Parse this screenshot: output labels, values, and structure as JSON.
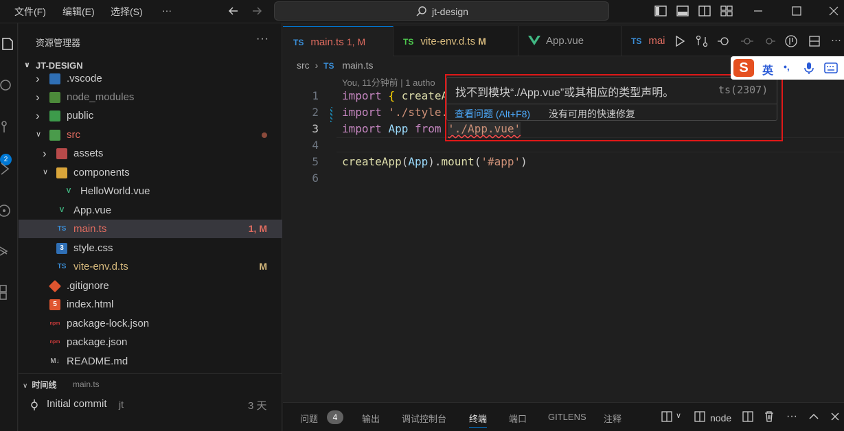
{
  "menu": [
    "文件(F)",
    "编辑(E)",
    "选择(S)",
    "···"
  ],
  "search": {
    "text": "jt-design"
  },
  "activity_badge": "2",
  "sidebar": {
    "title": "资源管理器",
    "more": "···",
    "project": "JT-DESIGN",
    "items": [
      {
        "name": ".vscode",
        "chevron": ">",
        "icon": "vscode-folder-icon",
        "color": "#cccccc"
      },
      {
        "name": "node_modules",
        "chevron": ">",
        "icon": "node-folder-icon",
        "color": "#8a8a8a"
      },
      {
        "name": "public",
        "chevron": ">",
        "icon": "public-folder-icon",
        "color": "#cccccc"
      },
      {
        "name": "src",
        "chevron": "v",
        "icon": "src-folder-icon",
        "color": "#e06c60"
      },
      {
        "name": "assets",
        "chevron": ">",
        "icon": "assets-folder-icon",
        "color": "#cccccc"
      },
      {
        "name": "components",
        "chevron": "v",
        "icon": "components-folder-icon",
        "color": "#cccccc"
      },
      {
        "name": "HelloWorld.vue",
        "chevron": "",
        "icon": "vue-icon",
        "color": "#cccccc"
      },
      {
        "name": "App.vue",
        "chevron": "",
        "icon": "vue-icon",
        "color": "#cccccc"
      },
      {
        "name": "main.ts",
        "chevron": "",
        "icon": "ts-icon",
        "color": "#e06c60",
        "deco": "1, M"
      },
      {
        "name": "style.css",
        "chevron": "",
        "icon": "css-icon",
        "color": "#cccccc"
      },
      {
        "name": "vite-env.d.ts",
        "chevron": "",
        "icon": "ts-icon",
        "color": "#d7ba7d",
        "deco": "M"
      },
      {
        "name": ".gitignore",
        "chevron": "",
        "icon": "git-icon",
        "color": "#cccccc"
      },
      {
        "name": "index.html",
        "chevron": "",
        "icon": "html-icon",
        "color": "#cccccc"
      },
      {
        "name": "package-lock.json",
        "chevron": "",
        "icon": "npm-icon",
        "color": "#cccccc"
      },
      {
        "name": "package.json",
        "chevron": "",
        "icon": "npm-icon",
        "color": "#cccccc"
      },
      {
        "name": "README.md",
        "chevron": "",
        "icon": "markdown-icon",
        "color": "#cccccc"
      }
    ],
    "timeline": {
      "title": "时间线",
      "file": "main.ts",
      "commit": "Initial commit",
      "author": "jt",
      "age": "3 天"
    }
  },
  "tabs": [
    {
      "prefix": "TS",
      "label": "main.ts",
      "deco": "1, M",
      "color": "#e06c60",
      "active": true
    },
    {
      "prefix": "TS",
      "label": "vite-env.d.ts",
      "deco": "M",
      "color": "#d7ba7d",
      "active": false
    },
    {
      "prefix": "V",
      "label": "App.vue",
      "deco": "",
      "color": "#9d9d9d",
      "active": false
    },
    {
      "prefix": "TS",
      "label": "mai",
      "deco": "",
      "color": "#e06c60",
      "active": false
    }
  ],
  "breadcrumb": {
    "folder": "src",
    "prefix": "TS",
    "file": "main.ts"
  },
  "editor": {
    "blame": "You, 11分钟前 | 1 autho",
    "lines": [
      {
        "n": "1",
        "t": [
          "import",
          " ",
          "{",
          " ",
          "createA"
        ]
      },
      {
        "n": "2",
        "t": [
          "import",
          " ",
          "'./style."
        ]
      },
      {
        "n": "3",
        "t": [
          "import",
          " ",
          "App",
          " ",
          "from",
          " ",
          "'./App.vue'"
        ]
      },
      {
        "n": "4",
        "t": []
      },
      {
        "n": "5",
        "t": [
          "createApp",
          "(",
          "App",
          ")",
          ".",
          "mount",
          "(",
          "'#app'",
          ")"
        ]
      },
      {
        "n": "6",
        "t": []
      }
    ]
  },
  "hover": {
    "message": "找不到模块“./App.vue”或其相应的类型声明。",
    "code": "ts(2307)",
    "link": "查看问题 (Alt+F8)",
    "nofix": "没有可用的快速修复"
  },
  "ime": {
    "logo": "S",
    "lang": "英",
    "punct": "•,"
  },
  "panel": {
    "tabs": [
      "问题",
      "输出",
      "调试控制台",
      "终端",
      "端口",
      "GITLENS",
      "注释"
    ],
    "problems_count": "4",
    "terminal": "node"
  }
}
